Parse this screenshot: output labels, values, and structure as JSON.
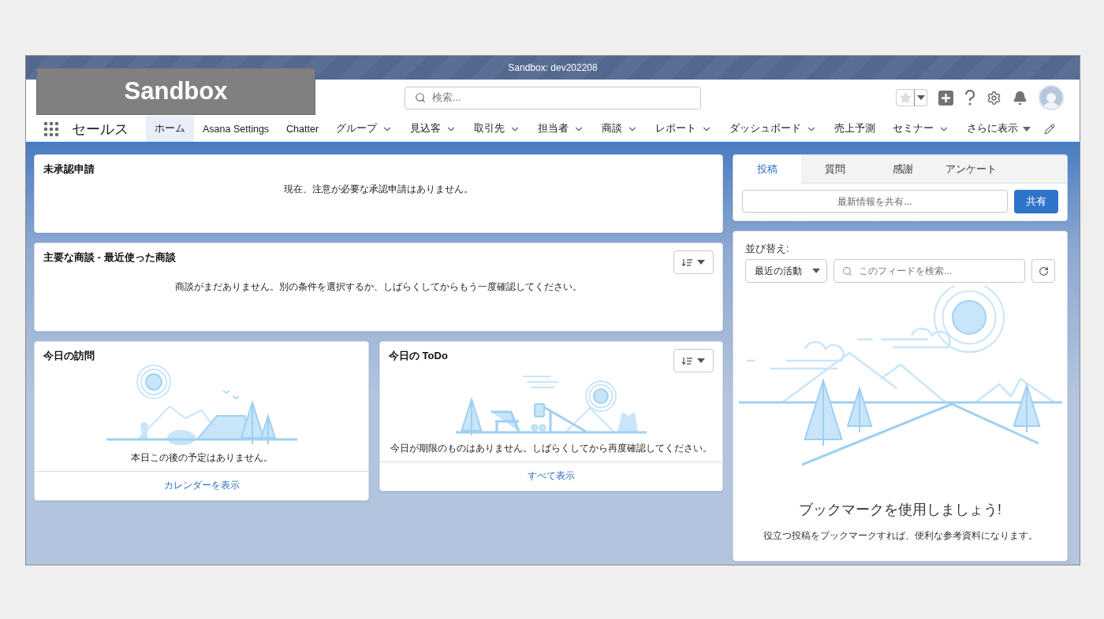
{
  "system_bar": {
    "text": "Sandbox: dev202208"
  },
  "overlay_label": {
    "text": "Sandbox"
  },
  "header": {
    "search": {
      "placeholder": "検索..."
    }
  },
  "app": {
    "name": "セールス"
  },
  "nav": {
    "items": [
      {
        "label": "ホーム",
        "selected": true,
        "menu": false
      },
      {
        "label": "Asana Settings",
        "selected": false,
        "menu": false
      },
      {
        "label": "Chatter",
        "selected": false,
        "menu": false
      },
      {
        "label": "グループ",
        "selected": false,
        "menu": true
      },
      {
        "label": "見込客",
        "selected": false,
        "menu": true
      },
      {
        "label": "取引先",
        "selected": false,
        "menu": true
      },
      {
        "label": "担当者",
        "selected": false,
        "menu": true
      },
      {
        "label": "商談",
        "selected": false,
        "menu": true
      },
      {
        "label": "レポート",
        "selected": false,
        "menu": true
      },
      {
        "label": "ダッシュボード",
        "selected": false,
        "menu": true
      },
      {
        "label": "売上予測",
        "selected": false,
        "menu": false
      },
      {
        "label": "セミナー",
        "selected": false,
        "menu": true
      }
    ],
    "more": {
      "label": "さらに表示"
    }
  },
  "approvals": {
    "title": "未承認申請",
    "message": "現在、注意が必要な承認申請はありません。"
  },
  "opportunities": {
    "title": "主要な商談 - 最近使った商談",
    "message": "商談がまだありません。別の条件を選択するか、しばらくしてからもう一度確認してください。"
  },
  "events": {
    "title": "今日の訪問",
    "message": "本日この後の予定はありません。",
    "link": "カレンダーを表示"
  },
  "tasks": {
    "title": "今日の ToDo",
    "message": "今日が期限のものはありません。しばらくしてから再度確認してください。",
    "link": "すべて表示"
  },
  "publisher": {
    "tabs": [
      {
        "label": "投稿",
        "selected": true
      },
      {
        "label": "質問",
        "selected": false
      },
      {
        "label": "感謝",
        "selected": false
      },
      {
        "label": "アンケート",
        "selected": false
      }
    ],
    "input": {
      "placeholder": "最新情報を共有..."
    },
    "button": "共有"
  },
  "feed": {
    "sort_label": "並び替え:",
    "sort_value": "最近の活動",
    "search": {
      "placeholder": "このフィードを検索..."
    },
    "empty_title": "ブックマークを使用しましょう!",
    "empty_text": "役立つ投稿をブックマークすれば、便利な参考資料になります。"
  }
}
